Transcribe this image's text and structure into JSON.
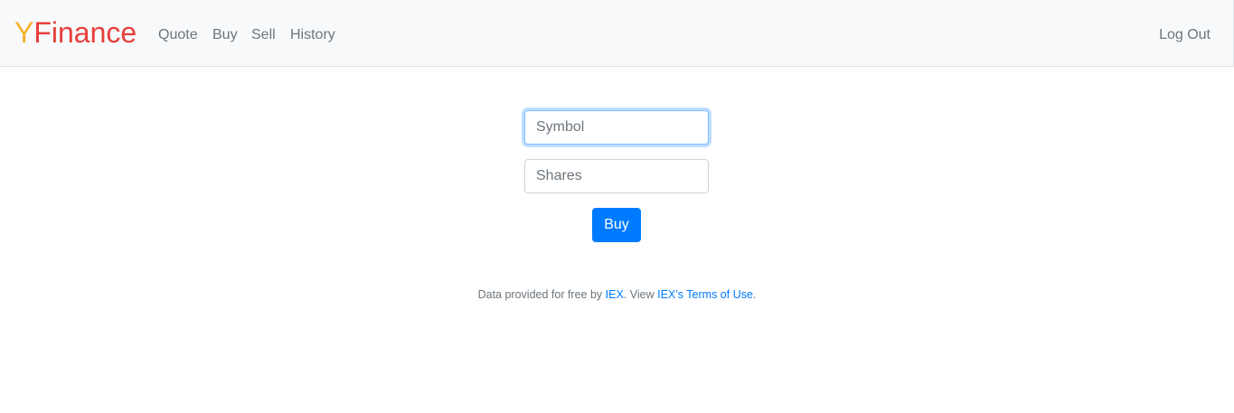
{
  "navbar": {
    "brand": {
      "first_letter": "Y",
      "rest": "Finance",
      "first_letter_color": "#f1b12d",
      "rest_color": "#e7403b"
    },
    "links": {
      "quote": "Quote",
      "buy": "Buy",
      "sell": "Sell",
      "history": "History"
    },
    "logout": "Log Out"
  },
  "form": {
    "symbol_placeholder": "Symbol",
    "shares_placeholder": "Shares",
    "symbol_value": "",
    "shares_value": "",
    "submit_label": "Buy"
  },
  "footer": {
    "prefix": "Data provided for free by ",
    "iex_link": "IEX",
    "middle": ". View ",
    "terms_link": "IEX’s Terms of Use",
    "suffix": "."
  },
  "colors": {
    "primary": "#007bff",
    "navbar_bg": "#f8f9fa",
    "muted_text": "#6c757d"
  }
}
